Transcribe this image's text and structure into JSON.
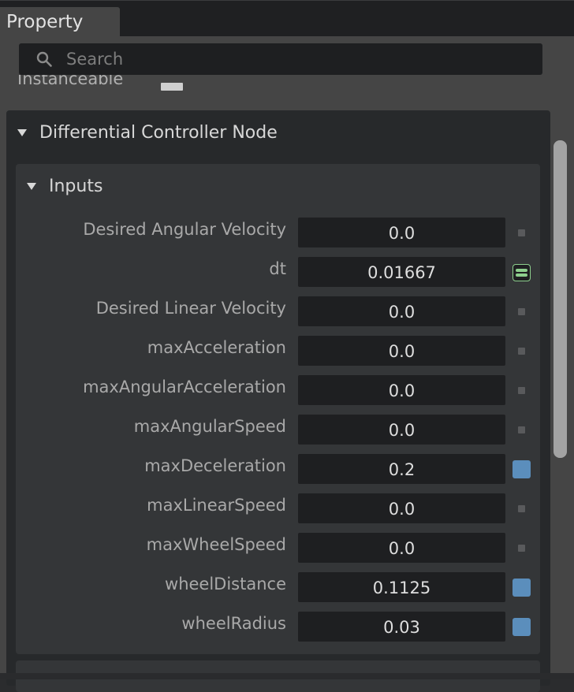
{
  "panel": {
    "tab_label": "Property",
    "search_placeholder": "Search",
    "clipped_label": "Instanceable"
  },
  "section": {
    "title": "Differential Controller Node",
    "inputs_title": "Inputs",
    "inputs": [
      {
        "label": "Desired Angular Velocity",
        "value": "0.0",
        "indicator": "off"
      },
      {
        "label": "dt",
        "value": "0.01667",
        "indicator": "connected"
      },
      {
        "label": "Desired Linear Velocity",
        "value": "0.0",
        "indicator": "off"
      },
      {
        "label": "maxAcceleration",
        "value": "0.0",
        "indicator": "off"
      },
      {
        "label": "maxAngularAcceleration",
        "value": "0.0",
        "indicator": "off"
      },
      {
        "label": "maxAngularSpeed",
        "value": "0.0",
        "indicator": "off"
      },
      {
        "label": "maxDeceleration",
        "value": "0.2",
        "indicator": "on"
      },
      {
        "label": "maxLinearSpeed",
        "value": "0.0",
        "indicator": "off"
      },
      {
        "label": "maxWheelSpeed",
        "value": "0.0",
        "indicator": "off"
      },
      {
        "label": "wheelDistance",
        "value": "0.1125",
        "indicator": "on"
      },
      {
        "label": "wheelRadius",
        "value": "0.03",
        "indicator": "on"
      }
    ]
  },
  "colors": {
    "accent_blue": "#5b8ebc",
    "connected_green": "#8dcf8d",
    "field_bg": "#1e1f21"
  }
}
